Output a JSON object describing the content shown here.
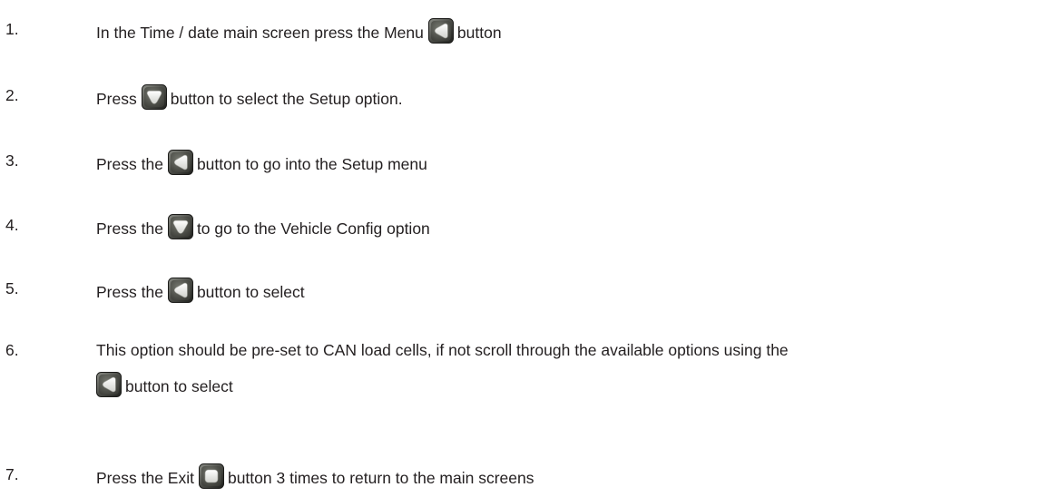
{
  "steps": [
    {
      "number": "1.",
      "text_a": "In the Time / date main screen press the Menu",
      "text_b": "button",
      "button_icon": "left-arrow-button-icon"
    },
    {
      "number": "2.",
      "text_a": "Press",
      "text_b": "button to select the Setup option.",
      "button_icon": "down-arrow-button-icon"
    },
    {
      "number": "3.",
      "text_a": "Press the",
      "text_b": "button to go into the Setup menu",
      "button_icon": "left-arrow-button-icon"
    },
    {
      "number": "4.",
      "text_a": "Press the",
      "text_b": "to go to the Vehicle Config option",
      "button_icon": "down-arrow-button-icon"
    },
    {
      "number": "5.",
      "text_a": "Press the",
      "text_b": "button to select",
      "button_icon": "left-arrow-button-icon"
    },
    {
      "number": "6.",
      "text_a": "This option should be pre-set to CAN load cells, if not scroll through the available options using the",
      "text_b": "button to select",
      "button_icon": "left-arrow-button-icon"
    },
    {
      "number": "7.",
      "text_a": "Press the Exit",
      "text_b": "button 3 times to return to the main screens",
      "button_icon": "square-button-icon"
    }
  ],
  "colors": {
    "text": "#231f20",
    "button_bezel": "#3a3a36",
    "button_face": "#5b5d58",
    "button_glyph": "#f1f1ee"
  }
}
